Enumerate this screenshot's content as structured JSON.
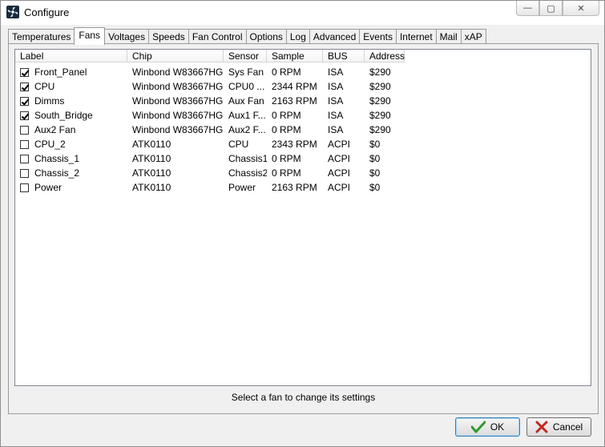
{
  "window": {
    "title": "Configure"
  },
  "caption": {
    "minimize": "—",
    "maximize": "▢",
    "close": "✕"
  },
  "tabs": [
    {
      "label": "Temperatures",
      "active": false
    },
    {
      "label": "Fans",
      "active": true
    },
    {
      "label": "Voltages",
      "active": false
    },
    {
      "label": "Speeds",
      "active": false
    },
    {
      "label": "Fan Control",
      "active": false
    },
    {
      "label": "Options",
      "active": false
    },
    {
      "label": "Log",
      "active": false
    },
    {
      "label": "Advanced",
      "active": false
    },
    {
      "label": "Events",
      "active": false
    },
    {
      "label": "Internet",
      "active": false
    },
    {
      "label": "Mail",
      "active": false
    },
    {
      "label": "xAP",
      "active": false
    }
  ],
  "columns": [
    "Label",
    "Chip",
    "Sensor",
    "Sample",
    "BUS",
    "Address"
  ],
  "rows": [
    {
      "checked": true,
      "label": "Front_Panel",
      "chip": "Winbond W83667HG",
      "sensor": "Sys Fan",
      "sample": "0 RPM",
      "bus": "ISA",
      "address": "$290"
    },
    {
      "checked": true,
      "label": "CPU",
      "chip": "Winbond W83667HG",
      "sensor": "CPU0 ...",
      "sample": "2344 RPM",
      "bus": "ISA",
      "address": "$290"
    },
    {
      "checked": true,
      "label": "Dimms",
      "chip": "Winbond W83667HG",
      "sensor": "Aux Fan",
      "sample": "2163 RPM",
      "bus": "ISA",
      "address": "$290"
    },
    {
      "checked": true,
      "label": "South_Bridge",
      "chip": "Winbond W83667HG",
      "sensor": "Aux1 F...",
      "sample": "0 RPM",
      "bus": "ISA",
      "address": "$290"
    },
    {
      "checked": false,
      "label": "Aux2 Fan",
      "chip": "Winbond W83667HG",
      "sensor": "Aux2 F...",
      "sample": "0 RPM",
      "bus": "ISA",
      "address": "$290"
    },
    {
      "checked": false,
      "label": "CPU_2",
      "chip": "ATK0110",
      "sensor": "CPU",
      "sample": "2343 RPM",
      "bus": "ACPI",
      "address": "$0"
    },
    {
      "checked": false,
      "label": "Chassis_1",
      "chip": "ATK0110",
      "sensor": "Chassis1",
      "sample": "0 RPM",
      "bus": "ACPI",
      "address": "$0"
    },
    {
      "checked": false,
      "label": "Chassis_2",
      "chip": "ATK0110",
      "sensor": "Chassis2",
      "sample": "0 RPM",
      "bus": "ACPI",
      "address": "$0"
    },
    {
      "checked": false,
      "label": "Power",
      "chip": "ATK0110",
      "sensor": "Power",
      "sample": "2163 RPM",
      "bus": "ACPI",
      "address": "$0"
    }
  ],
  "status": "Select a fan to change its settings",
  "buttons": {
    "ok": "OK",
    "cancel": "Cancel"
  },
  "colors": {
    "ok_icon": "#2e9b2e",
    "cancel_icon": "#c0281e"
  }
}
